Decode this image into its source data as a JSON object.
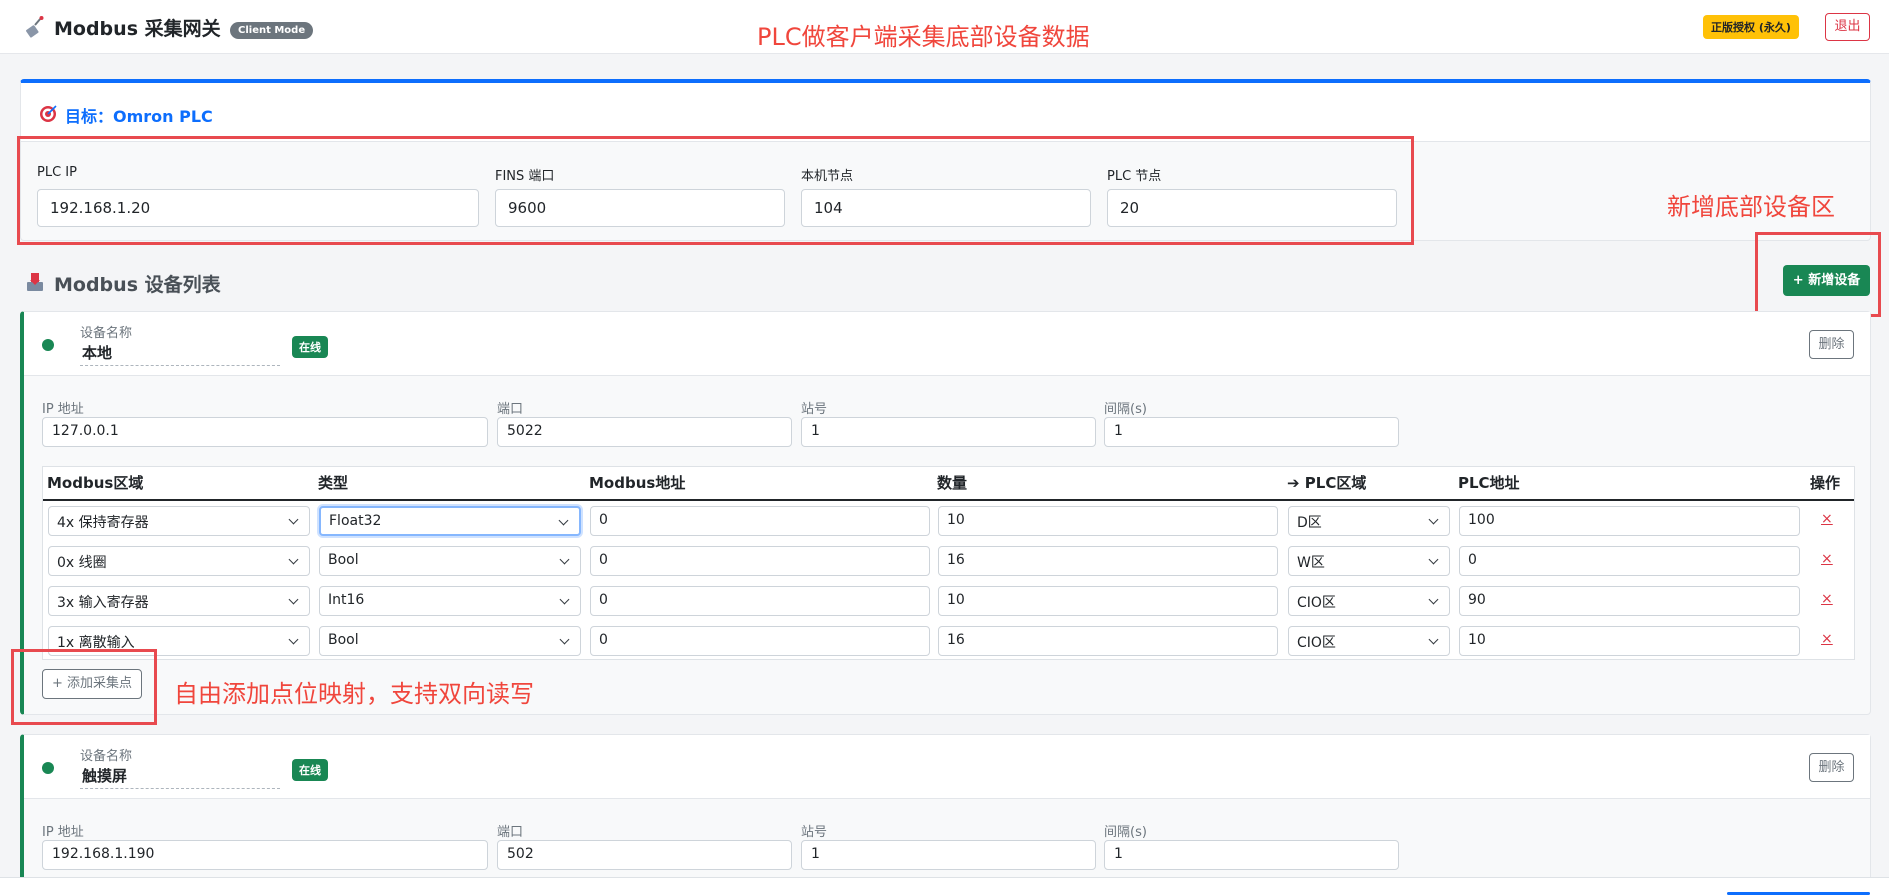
{
  "header": {
    "app_title": "Modbus 采集网关",
    "mode_badge": "Client Mode",
    "license_badge": "正版授权 (永久)",
    "logout_label": "退出",
    "icons": [
      "satellite-icon"
    ]
  },
  "annotations": {
    "top_note": "PLC做客户端采集底部设备数据",
    "add_device_note": "新增底部设备区",
    "add_point_note": "自由添加点位映射，支持双向读写"
  },
  "target": {
    "title": "目标：Omron PLC",
    "plc_ip_label": "PLC IP",
    "plc_ip": "192.168.1.20",
    "fins_port_label": "FINS 端口",
    "fins_port": "9600",
    "local_node_label": "本机节点",
    "local_node": "104",
    "plc_node_label": "PLC 节点",
    "plc_node": "20",
    "accent_color": "#0d6efd"
  },
  "device_section": {
    "title": "Modbus 设备列表",
    "add_device_label": "+ 新增设备"
  },
  "field_labels": {
    "device_name": "设备名称",
    "ip": "IP 地址",
    "port": "端口",
    "station": "站号",
    "interval": "间隔(s)",
    "delete": "删除",
    "online": "在线",
    "add_point": "+ 添加采集点"
  },
  "table_headers": [
    "Modbus区域",
    "类型",
    "Modbus地址",
    "数量",
    "➔ PLC区域",
    "PLC地址",
    "操作"
  ],
  "devices": [
    {
      "name": "本地",
      "ip": "127.0.0.1",
      "port": "5022",
      "station": "1",
      "interval": "1",
      "rows": [
        {
          "area": "4x 保持寄存器",
          "type": "Float32",
          "addr": "0",
          "count": "10",
          "plc_area": "D区",
          "plc_addr": "100",
          "op": "×"
        },
        {
          "area": "0x 线圈",
          "type": "Bool",
          "addr": "0",
          "count": "16",
          "plc_area": "W区",
          "plc_addr": "0",
          "op": "×"
        },
        {
          "area": "3x 输入寄存器",
          "type": "Int16",
          "addr": "0",
          "count": "10",
          "plc_area": "CIO区",
          "plc_addr": "90",
          "op": "×"
        },
        {
          "area": "1x 离散输入",
          "type": "Bool",
          "addr": "0",
          "count": "16",
          "plc_area": "CIO区",
          "plc_addr": "10",
          "op": "×"
        }
      ]
    },
    {
      "name": "触摸屏",
      "ip": "192.168.1.190",
      "port": "502",
      "station": "1",
      "interval": "1"
    }
  ],
  "colors": {
    "success": "#198754",
    "danger": "#dc3545",
    "warning": "#ffc107",
    "annotation": "#f0463c"
  }
}
